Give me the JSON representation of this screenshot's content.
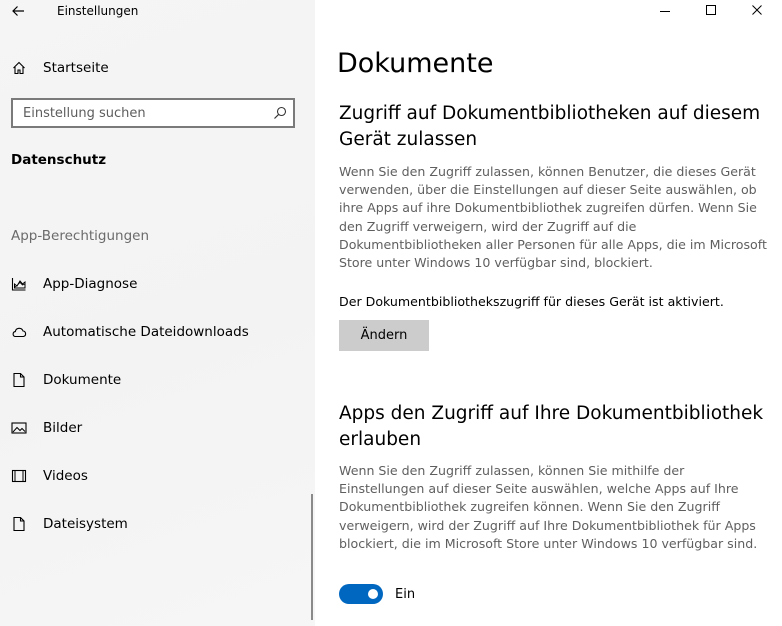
{
  "window": {
    "title": "Einstellungen",
    "controls": [
      "minimize",
      "maximize",
      "close"
    ]
  },
  "sidebar": {
    "home_label": "Startseite",
    "search": {
      "placeholder": "Einstellung suchen",
      "value": ""
    },
    "active_section": "Datenschutz",
    "group_header": "App-Berechtigungen",
    "items": [
      {
        "label": "App-Diagnose",
        "icon": "app-diagnostics-icon"
      },
      {
        "label": "Automatische Dateidownloads",
        "icon": "cloud-icon"
      },
      {
        "label": "Dokumente",
        "icon": "document-icon"
      },
      {
        "label": "Bilder",
        "icon": "image-icon"
      },
      {
        "label": "Videos",
        "icon": "video-icon"
      },
      {
        "label": "Dateisystem",
        "icon": "file-system-icon"
      }
    ]
  },
  "main": {
    "page_title": "Dokumente",
    "section1": {
      "heading": "Zugriff auf Dokumentbibliotheken auf diesem Gerät zulassen",
      "description": "Wenn Sie den Zugriff zulassen, können Benutzer, die dieses Gerät verwenden, über die Einstellungen auf dieser Seite auswählen, ob ihre Apps auf ihre Dokumentbibliothek zugreifen dürfen. Wenn Sie den Zugriff verweigern, wird der Zugriff auf die Dokumentbibliotheken aller Personen für alle Apps, die im Microsoft Store unter Windows 10 verfügbar sind, blockiert.",
      "status": "Der Dokumentbibliothekszugriff für dieses Gerät ist aktiviert.",
      "button_label": "Ändern"
    },
    "section2": {
      "heading": "Apps den Zugriff auf Ihre Dokumentbibliothek erlauben",
      "description": "Wenn Sie den Zugriff zulassen, können Sie mithilfe der Einstellungen auf dieser Seite auswählen, welche Apps auf Ihre Dokumentbibliothek zugreifen können. Wenn Sie den Zugriff verweigern, wird der Zugriff auf Ihre Dokumentbibliothek für Apps blockiert, die im Microsoft Store unter Windows 10 verfügbar sind.",
      "toggle_state": true,
      "toggle_label": "Ein"
    }
  },
  "colors": {
    "accent": "#0067c0",
    "sidebar_bg": "#f3f3f3",
    "button_bg": "#cccccc",
    "description_text": "#5f5f5f"
  }
}
